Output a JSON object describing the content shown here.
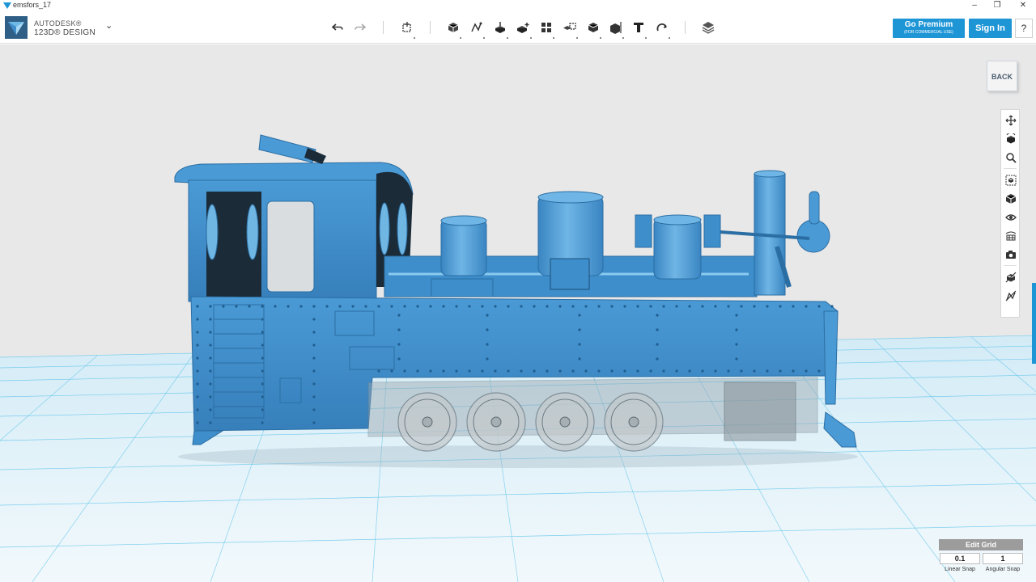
{
  "window": {
    "title": "emsfors_17",
    "controls": {
      "minimize": "–",
      "maximize": "❐",
      "close": "✕"
    }
  },
  "brand": {
    "company": "AUTODESK®",
    "product": "123D® DESIGN",
    "menu_caret": "⌄"
  },
  "toolbar": {
    "tools": [
      {
        "id": "undo",
        "icon": "undo-icon"
      },
      {
        "id": "redo",
        "icon": "redo-icon"
      },
      {
        "id": "transform",
        "icon": "transform-icon"
      },
      {
        "id": "primitives",
        "icon": "primitives-icon"
      },
      {
        "id": "sketch",
        "icon": "sketch-icon"
      },
      {
        "id": "construct",
        "icon": "construct-icon"
      },
      {
        "id": "modify",
        "icon": "modify-icon"
      },
      {
        "id": "pattern",
        "icon": "pattern-icon"
      },
      {
        "id": "grouping",
        "icon": "grouping-icon"
      },
      {
        "id": "combine",
        "icon": "combine-icon"
      },
      {
        "id": "measure",
        "icon": "measure-icon"
      },
      {
        "id": "text",
        "icon": "text-icon",
        "glyph": "T"
      },
      {
        "id": "snap",
        "icon": "snap-icon"
      },
      {
        "id": "material",
        "icon": "material-icon"
      }
    ],
    "premium_label": "Go Premium",
    "premium_sub": "(FOR COMMERCIAL USE)",
    "signin_label": "Sign In",
    "help_label": "?"
  },
  "viewcube": {
    "label": "BACK"
  },
  "navigation": [
    {
      "id": "pan",
      "icon": "pan-icon"
    },
    {
      "id": "orbit",
      "icon": "orbit-icon"
    },
    {
      "id": "zoom",
      "icon": "zoom-icon"
    },
    {
      "id": "fit",
      "icon": "fit-icon"
    },
    {
      "id": "views",
      "icon": "view-cube-icon"
    },
    {
      "id": "visibility",
      "icon": "eye-icon"
    },
    {
      "id": "materials",
      "icon": "material-display-icon"
    },
    {
      "id": "screenshot",
      "icon": "camera-icon"
    },
    {
      "id": "visual-style",
      "icon": "visual-style-icon"
    },
    {
      "id": "hide-sketch",
      "icon": "hide-sketch-icon"
    }
  ],
  "grid": {
    "edit_label": "Edit Grid",
    "linear_snap_value": "0.1",
    "linear_snap_label": "Linear Snap",
    "angular_snap_value": "1",
    "angular_snap_label": "Angular Snap"
  },
  "colors": {
    "accent": "#1e96d6",
    "model": "#3d8ecb",
    "model_dark": "#2b6ea3",
    "grid_line": "#5ec3ea",
    "background": "#e8e8e8"
  }
}
